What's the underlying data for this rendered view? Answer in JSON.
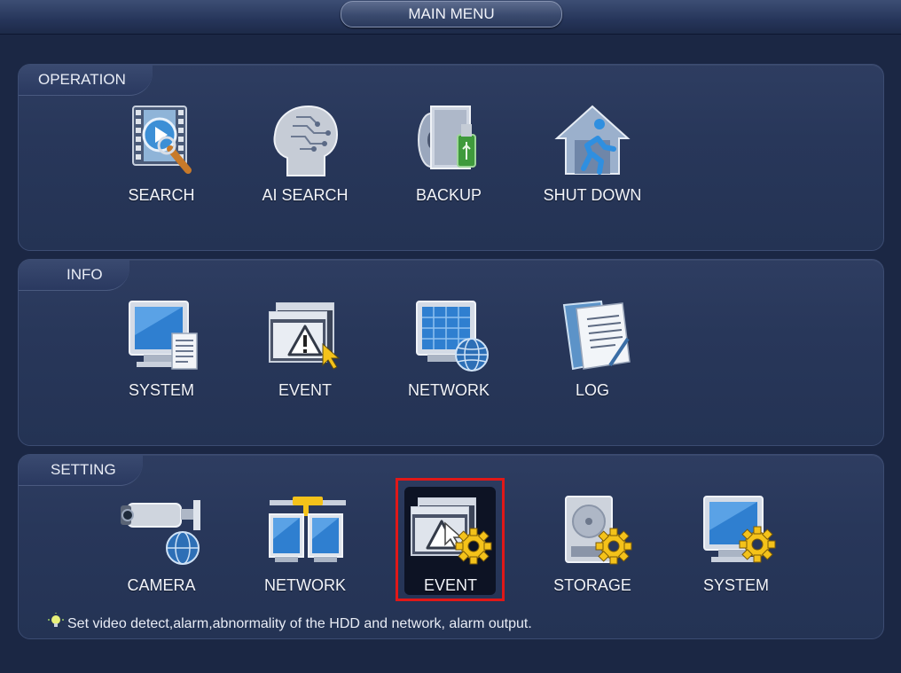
{
  "window": {
    "title": "MAIN MENU"
  },
  "sections": {
    "operation": {
      "title": "OPERATION",
      "items": [
        {
          "label": "SEARCH",
          "icon": "video-search-icon"
        },
        {
          "label": "AI SEARCH",
          "icon": "ai-head-icon"
        },
        {
          "label": "BACKUP",
          "icon": "backup-usb-icon"
        },
        {
          "label": "SHUT DOWN",
          "icon": "shutdown-house-icon"
        }
      ]
    },
    "info": {
      "title": "INFO",
      "items": [
        {
          "label": "SYSTEM",
          "icon": "monitor-document-icon"
        },
        {
          "label": "EVENT",
          "icon": "warning-window-icon"
        },
        {
          "label": "NETWORK",
          "icon": "monitor-globe-icon"
        },
        {
          "label": "LOG",
          "icon": "log-notebook-icon"
        }
      ]
    },
    "setting": {
      "title": "SETTING",
      "items": [
        {
          "label": "CAMERA",
          "icon": "camera-globe-icon"
        },
        {
          "label": "NETWORK",
          "icon": "network-panels-icon"
        },
        {
          "label": "EVENT",
          "icon": "event-gear-icon",
          "selected": true
        },
        {
          "label": "STORAGE",
          "icon": "hdd-gear-icon"
        },
        {
          "label": "SYSTEM",
          "icon": "monitor-gear-icon"
        }
      ]
    }
  },
  "hint": {
    "text": "Set video detect,alarm,abnormality of the HDD and network, alarm output."
  },
  "colors": {
    "background": "#1b2744",
    "panel": "#28375a",
    "selection_border": "#e01818",
    "gear": "#f4c21a"
  }
}
